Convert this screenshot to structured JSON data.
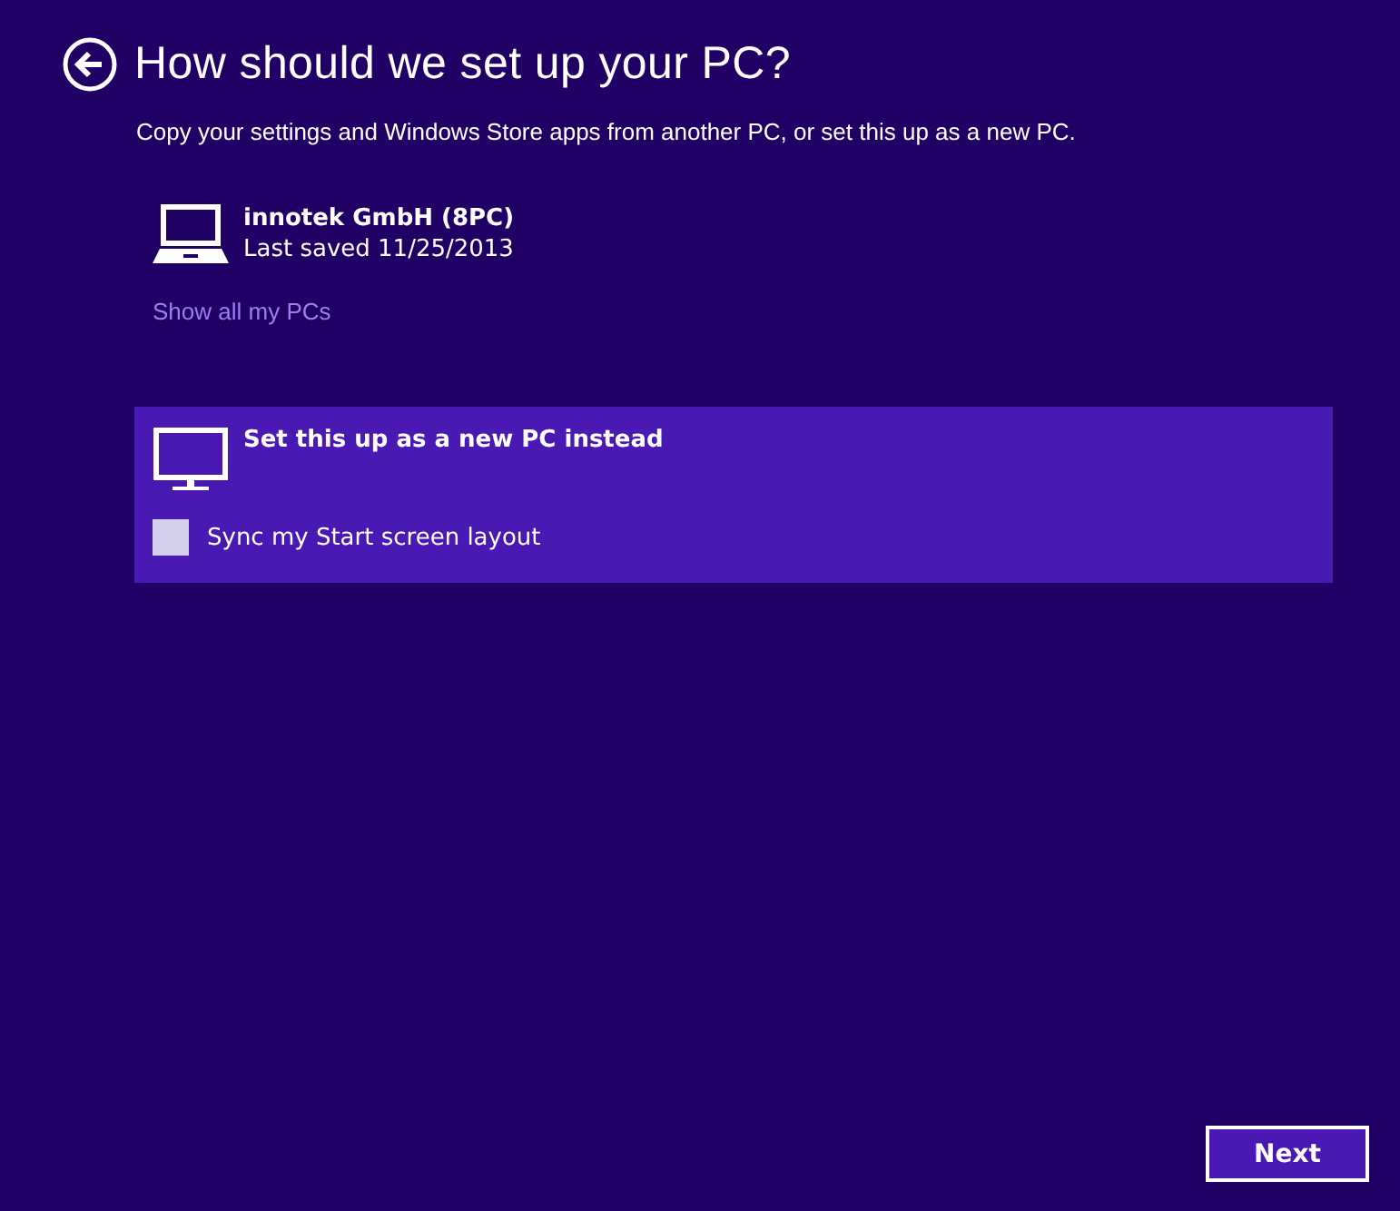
{
  "header": {
    "title": "How should we set up your PC?",
    "subtitle": "Copy your settings and Windows Store apps from another PC, or set this up as a new PC."
  },
  "saved_pcs": [
    {
      "name": "innotek GmbH (8PC)",
      "last_saved": "Last saved 11/25/2013",
      "selected": false
    }
  ],
  "show_all_link": "Show all my PCs",
  "new_pc_option": {
    "label": "Set this up as a new PC instead",
    "selected": true,
    "sync_checkbox": {
      "label": "Sync my Start screen layout",
      "checked": false
    }
  },
  "buttons": [
    "Next"
  ]
}
